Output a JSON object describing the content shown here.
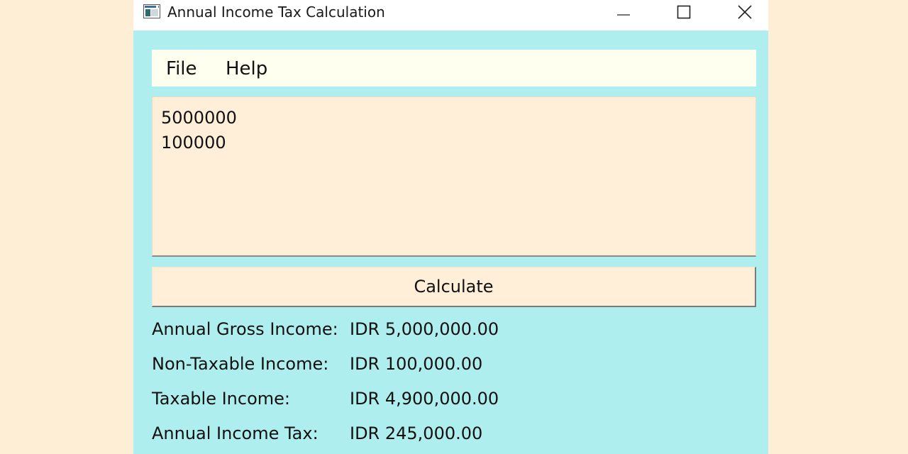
{
  "window": {
    "title": "Annual Income Tax Calculation",
    "icon": "window-app-icon",
    "controls": [
      "minimize-icon",
      "maximize-icon",
      "close-icon"
    ]
  },
  "menu": {
    "file_label": "File",
    "help_label": "Help"
  },
  "input": {
    "lines": [
      "5000000",
      "100000"
    ]
  },
  "calculate_label": "Calculate",
  "results": [
    {
      "label": "Annual Gross Income:",
      "value": "IDR 5,000,000.00"
    },
    {
      "label": "Non-Taxable Income:",
      "value": "IDR 100,000.00"
    },
    {
      "label": "Taxable Income:",
      "value": "IDR 4,900,000.00"
    },
    {
      "label": "Annual Income Tax:",
      "value": "IDR 245,000.00"
    }
  ],
  "colors": {
    "background": "#FEEED6",
    "window_body": "#AFEEEE",
    "menubar": "#FFFFF0",
    "input_field": "#FFEED8",
    "button": "#FFEED8"
  }
}
